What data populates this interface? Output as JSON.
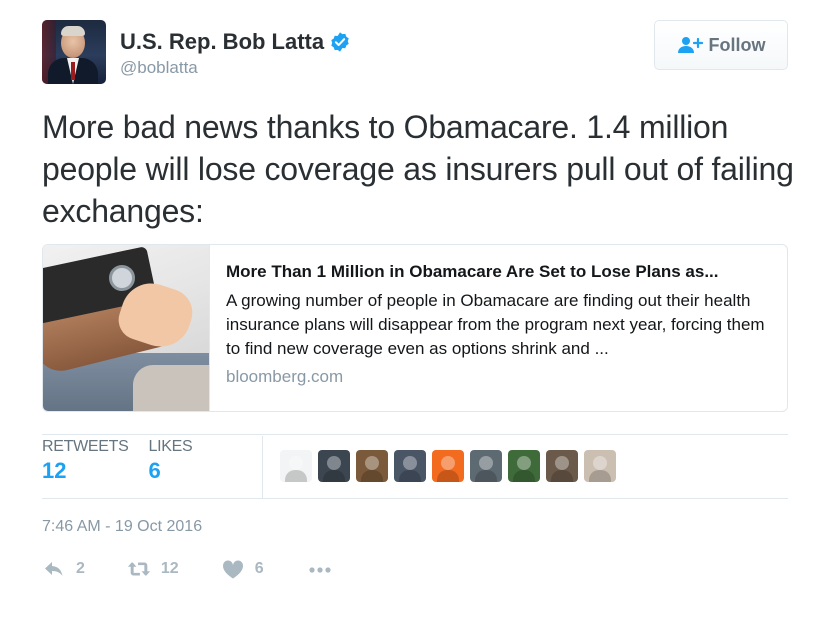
{
  "colors": {
    "accent": "#1da1f2",
    "verified": "#1da1f2",
    "muted": "#8899a6",
    "text": "#292f33"
  },
  "author": {
    "display_name": "U.S. Rep. Bob Latta",
    "handle": "@boblatta",
    "verified": true,
    "avatar_icon": "profile-photo"
  },
  "follow_button": {
    "label": "Follow",
    "icon": "follow-user-plus-icon"
  },
  "tweet": {
    "text": "More bad news thanks to Obamacare. 1.4 million people will lose coverage as insurers pull out of failing exchanges:"
  },
  "card": {
    "image_icon": "blood-pressure-cuff-photo",
    "title": "More Than 1 Million in Obamacare Are Set to Lose Plans as...",
    "description": "A growing number of people in Obamacare are finding out their health insurance plans will disappear from the program next year, forcing them to find new coverage even as options shrink and ...",
    "domain": "bloomberg.com"
  },
  "stats": {
    "retweets_label": "RETWEETS",
    "retweets_value": "12",
    "likes_label": "LIKES",
    "likes_value": "6"
  },
  "likers": [
    {
      "name": "liker-avatar-1",
      "color": "#f2f4f5"
    },
    {
      "name": "liker-avatar-2",
      "color": "#3c4650"
    },
    {
      "name": "liker-avatar-3",
      "color": "#7a5a3a"
    },
    {
      "name": "liker-avatar-4",
      "color": "#4a5566"
    },
    {
      "name": "liker-avatar-5",
      "color": "#f26b1f"
    },
    {
      "name": "liker-avatar-6",
      "color": "#5e6a72"
    },
    {
      "name": "liker-avatar-7",
      "color": "#3f6b3a"
    },
    {
      "name": "liker-avatar-8",
      "color": "#6b5a4a"
    },
    {
      "name": "liker-avatar-9",
      "color": "#cbbfb2"
    }
  ],
  "timestamp": "7:46 AM - 19 Oct 2016",
  "actions": {
    "reply": {
      "icon": "reply-icon",
      "count": "2"
    },
    "retweet": {
      "icon": "retweet-icon",
      "count": "12"
    },
    "like": {
      "icon": "heart-icon",
      "count": "6"
    },
    "more": {
      "icon": "more-dots-icon"
    }
  }
}
